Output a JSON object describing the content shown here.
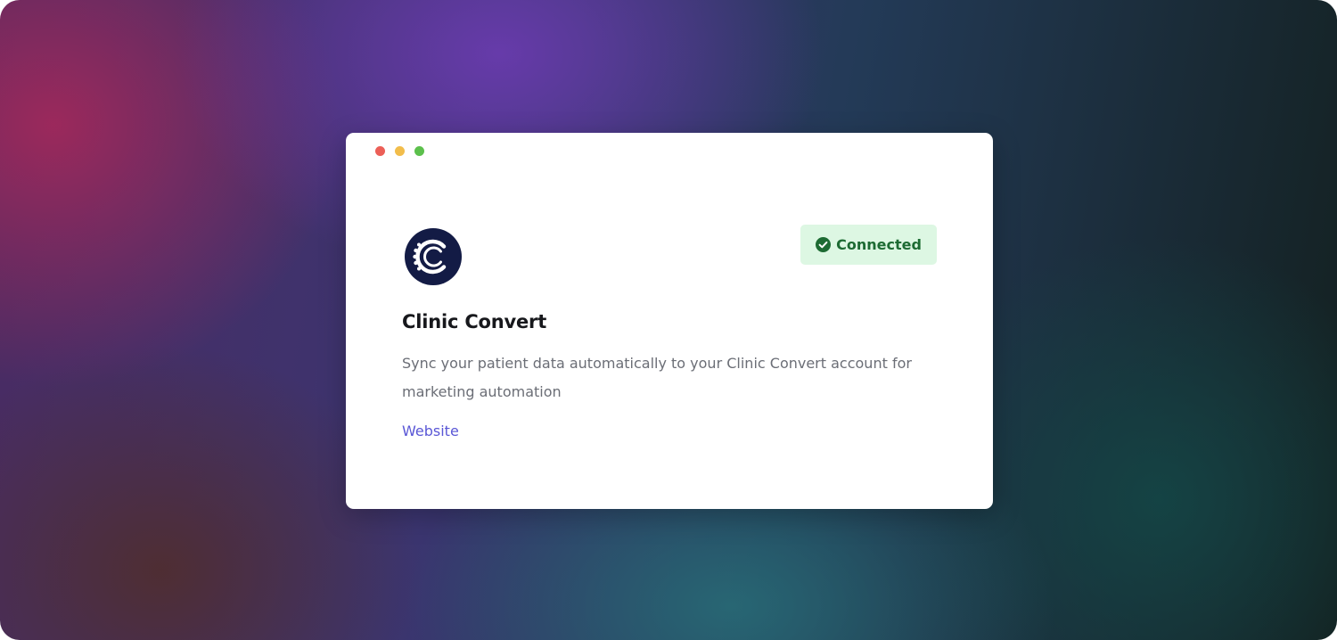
{
  "colors": {
    "card_bg": "#ffffff",
    "dot_close": "#ec5f57",
    "dot_minimize": "#f2bd4b",
    "dot_maximize": "#5cc04c",
    "logo_bg": "#131b45",
    "badge_bg": "#ddf7e3",
    "badge_text": "#1d6b33",
    "badge_icon": "#1d6b33",
    "link": "#5a57d6"
  },
  "integration": {
    "name": "Clinic Convert",
    "logo_icon": "clinic-convert-logo-icon",
    "status_icon": "check-circle-icon",
    "status": "Connected",
    "description": "Sync your patient data automatically to your Clinic Convert account for marketing automation",
    "website_label": "Website"
  }
}
